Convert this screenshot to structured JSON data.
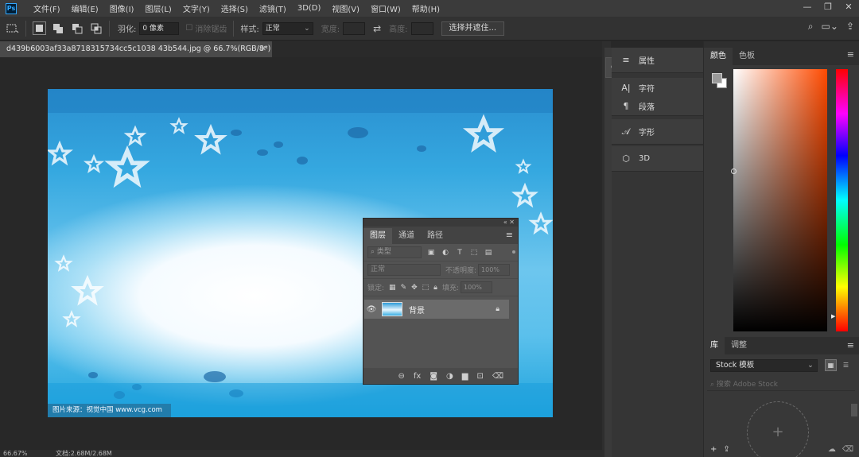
{
  "menubar": {
    "logo": "Ps",
    "items": [
      "文件(F)",
      "编辑(E)",
      "图像(I)",
      "图层(L)",
      "文字(Y)",
      "选择(S)",
      "滤镜(T)",
      "3D(D)",
      "视图(V)",
      "窗口(W)",
      "帮助(H)"
    ],
    "window_controls": [
      "—",
      "❐",
      "✕"
    ]
  },
  "options": {
    "feather_label": "羽化:",
    "feather_value": "0 像素",
    "antialias_label": "消除锯齿",
    "style_label": "样式:",
    "style_value": "正常",
    "width_label": "宽度:",
    "height_label": "高度:",
    "mask_button": "选择并遮住..."
  },
  "document": {
    "tab_title": "d439b6003af33a8718315734cc5c1038 43b544.jpg @ 66.7%(RGB/8*)",
    "image_caption": "图片来源：视觉中国 www.vcg.com"
  },
  "status": {
    "zoom": "66.67%",
    "doc_info": "文档:2.68M/2.68M"
  },
  "layers_panel": {
    "tabs": [
      "图层",
      "通道",
      "路径"
    ],
    "filter_placeholder": "类型",
    "blend_mode": "正常",
    "opacity_label": "不透明度:",
    "opacity_value": "100%",
    "lock_label": "锁定:",
    "fill_label": "填充:",
    "fill_value": "100%",
    "layer_name": "背景",
    "footer_icons": [
      "link-icon",
      "fx-icon",
      "mask-icon",
      "adjustment-icon",
      "folder-icon",
      "new-layer-icon",
      "trash-icon"
    ]
  },
  "mini_panels": {
    "items": [
      "属性",
      "字符",
      "段落",
      "字形",
      "3D"
    ]
  },
  "color_panel": {
    "tabs": [
      "颜色",
      "色板"
    ],
    "foreground": "#9a9a9a",
    "background": "#ffffff",
    "hue_color": "#ff4a00"
  },
  "library_panel": {
    "tabs": [
      "库",
      "调整"
    ],
    "library_name": "Stock 模板",
    "search_placeholder": "搜索 Adobe Stock"
  }
}
